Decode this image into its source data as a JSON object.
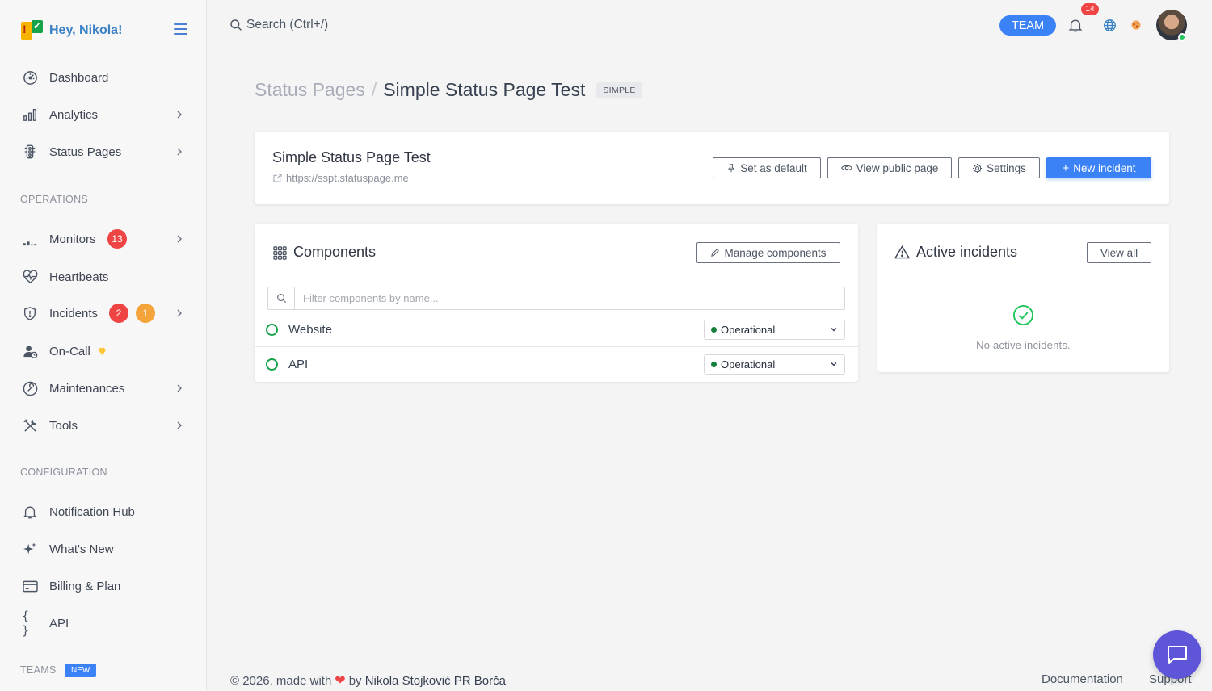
{
  "brand": {
    "greeting": "Hey, Nikola!"
  },
  "sidebar": {
    "items": [
      {
        "label": "Dashboard",
        "icon": "dashboard-icon"
      },
      {
        "label": "Analytics",
        "icon": "bar-chart-icon"
      },
      {
        "label": "Status Pages",
        "icon": "traffic-light-icon"
      }
    ],
    "operations_title": "OPERATIONS",
    "operations": [
      {
        "label": "Monitors",
        "badge": "13",
        "icon": "monitor-signal-icon"
      },
      {
        "label": "Heartbeats",
        "icon": "heartbeat-icon"
      },
      {
        "label": "Incidents",
        "badge_red": "2",
        "badge_orange": "1",
        "icon": "shield-icon"
      },
      {
        "label": "On-Call",
        "icon": "user-clock-icon"
      },
      {
        "label": "Maintenances",
        "icon": "wrench-circle-icon"
      },
      {
        "label": "Tools",
        "icon": "tools-icon"
      }
    ],
    "configuration_title": "CONFIGURATION",
    "configuration": [
      {
        "label": "Notification Hub",
        "icon": "bell-icon"
      },
      {
        "label": "What's New",
        "icon": "sparkles-icon"
      },
      {
        "label": "Billing & Plan",
        "icon": "credit-card-icon"
      },
      {
        "label": "API",
        "icon": "braces-icon"
      }
    ],
    "teams_title": "TEAMS",
    "teams_badge": "NEW"
  },
  "topbar": {
    "search_label": "Search (Ctrl+/)",
    "team_label": "TEAM",
    "notification_count": "14"
  },
  "breadcrumb": {
    "parent": "Status Pages",
    "separator": "/",
    "current": "Simple Status Page Test",
    "tag": "SIMPLE"
  },
  "header_card": {
    "title": "Simple Status Page Test",
    "url": "https://sspt.statuspage.me",
    "buttons": {
      "set_default": "Set as default",
      "view_public": "View public page",
      "settings": "Settings",
      "new_incident": "New incident"
    }
  },
  "components": {
    "title": "Components",
    "manage_label": "Manage components",
    "filter_placeholder": "Filter components by name...",
    "rows": [
      {
        "name": "Website",
        "status": "Operational"
      },
      {
        "name": "API",
        "status": "Operational"
      }
    ]
  },
  "incidents": {
    "title": "Active incidents",
    "view_all": "View all",
    "empty_text": "No active incidents."
  },
  "footer": {
    "prefix": "© 2026, made with",
    "by": "by",
    "author": "Nikola Stojković PR Borča",
    "documentation": "Documentation",
    "support": "Support"
  },
  "colors": {
    "accent": "#3b82f6",
    "success": "#16a34a",
    "danger": "#ef4444",
    "warning": "#f5a33b",
    "chat": "#5f55d9"
  }
}
